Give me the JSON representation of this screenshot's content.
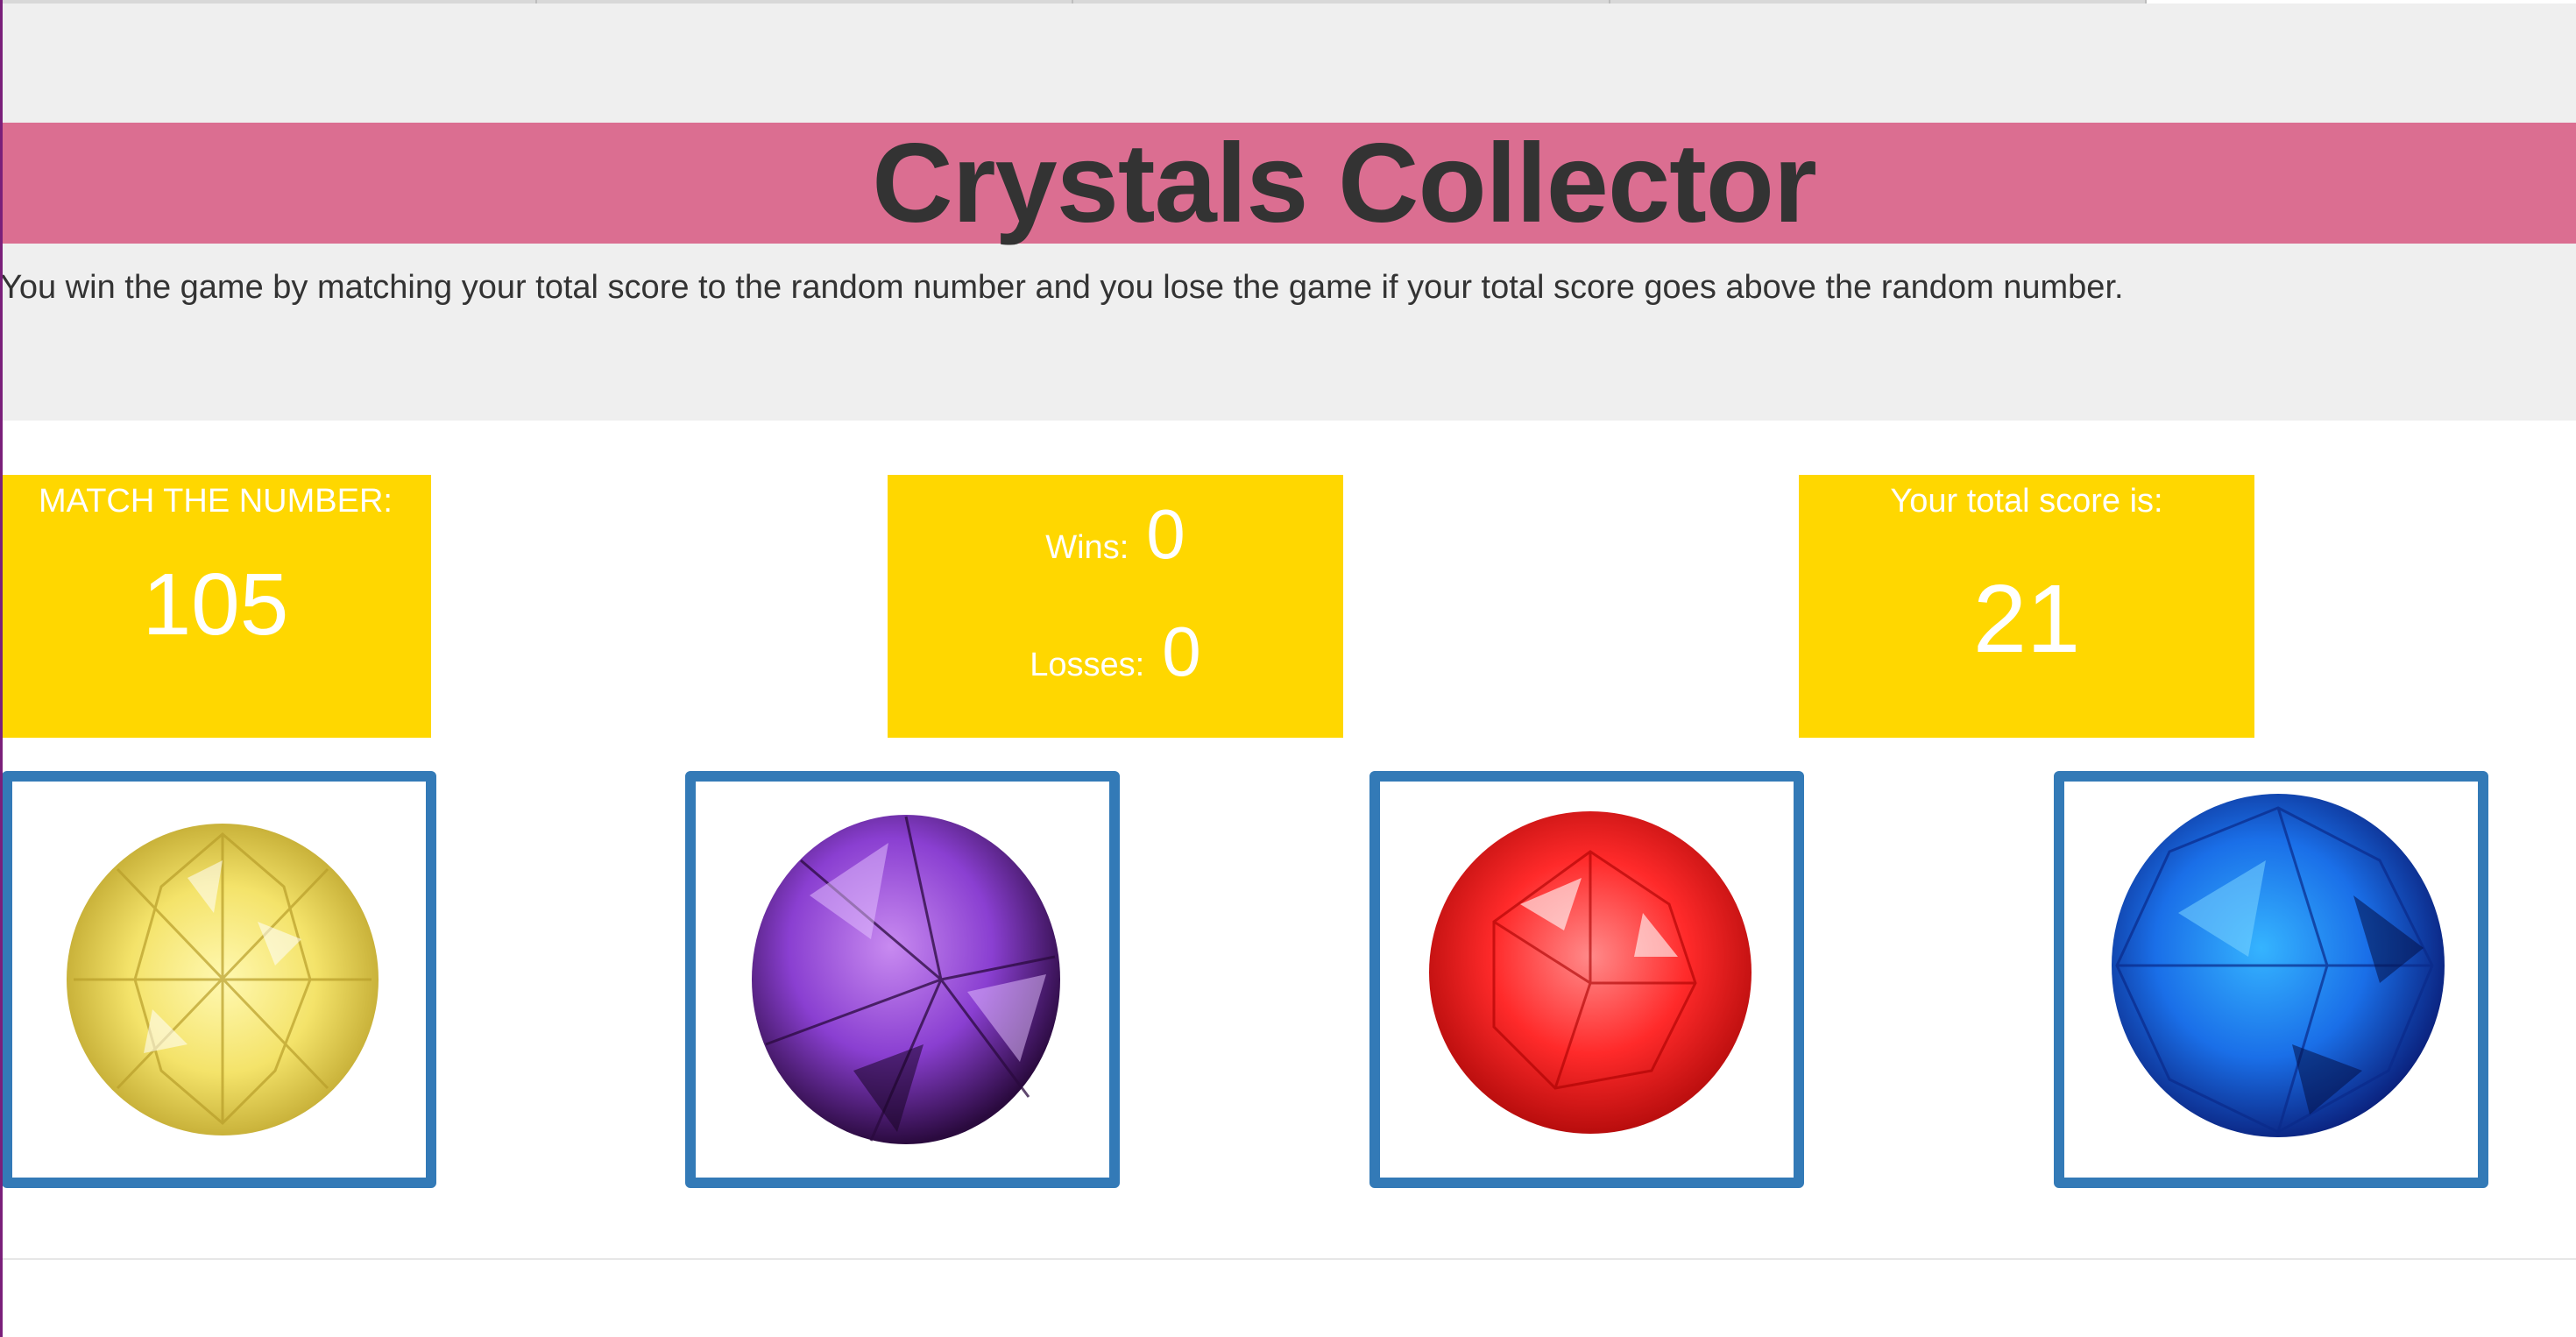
{
  "game": {
    "title": "Crystals Collector",
    "instructions": "You win the game by matching your total score to the random number and you lose the game if your total score goes above the random number."
  },
  "target": {
    "label": "MATCH THE NUMBER:",
    "value": "105"
  },
  "record": {
    "wins_label": "Wins:",
    "wins": "0",
    "losses_label": "Losses:",
    "losses": "0"
  },
  "score": {
    "label": "Your total score is:",
    "value": "21"
  },
  "crystals": [
    {
      "name": "yellow-crystal",
      "color": "#f2e25a"
    },
    {
      "name": "purple-crystal",
      "color": "#8a3fd1"
    },
    {
      "name": "red-crystal",
      "color": "#ff2a2a"
    },
    {
      "name": "blue-crystal",
      "color": "#1a6fe8"
    }
  ],
  "colors": {
    "title_band": "#db6e91",
    "jumbotron_bg": "#efefef",
    "panel_bg": "#ffd700",
    "crystal_border": "#337ab7",
    "text_dark": "#333333"
  }
}
